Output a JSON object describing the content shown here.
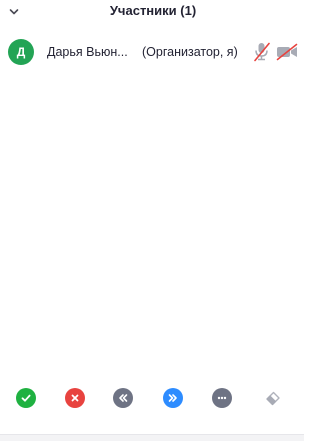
{
  "header": {
    "title": "Участники (1)",
    "collapse_icon": "chevron-down-icon"
  },
  "participants": [
    {
      "initial": "Д",
      "name": "Дарья Вьюн...",
      "role": "(Организатор, я)",
      "avatar_color": "#23a455",
      "mic_icon": "mic-muted-icon",
      "video_icon": "video-off-icon"
    }
  ],
  "footer": {
    "buttons": [
      {
        "icon": "check-icon",
        "color": "#1fb141"
      },
      {
        "icon": "close-icon",
        "color": "#e8433f"
      },
      {
        "icon": "rewind-icon",
        "color": "#6e7384"
      },
      {
        "icon": "fast-forward-icon",
        "color": "#2d8cff"
      },
      {
        "icon": "more-icon",
        "color": "#6e7384"
      },
      {
        "icon": "eraser-icon",
        "color": "#a8abb5"
      }
    ]
  },
  "colors": {
    "muted_red": "#e8433f",
    "icon_gray": "#a8abb5"
  }
}
